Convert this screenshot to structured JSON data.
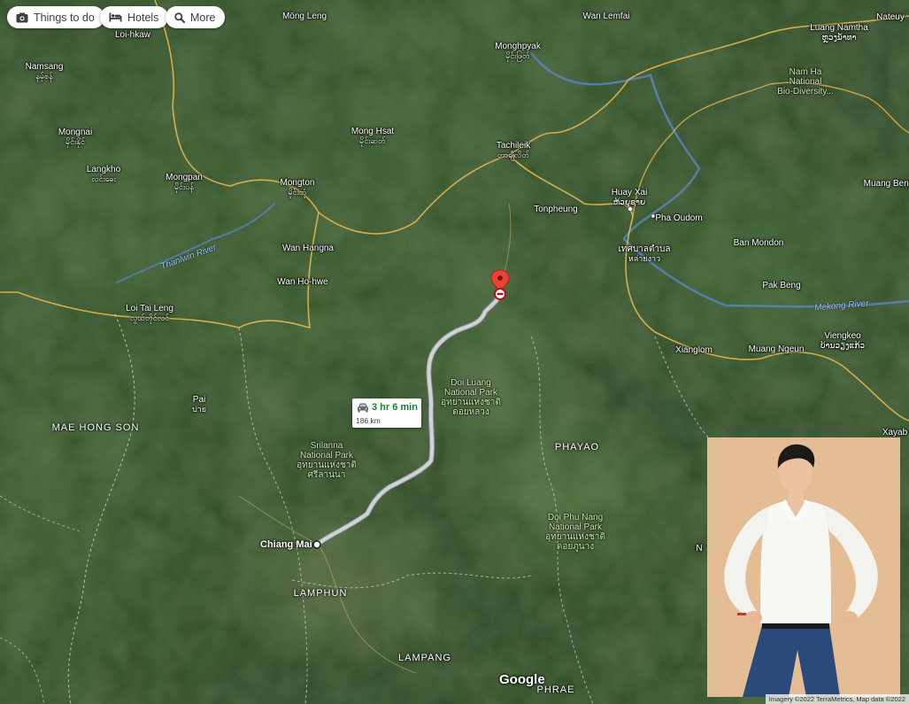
{
  "toolbar": {
    "chips": [
      {
        "label": "Things to do",
        "icon": "camera-icon"
      },
      {
        "label": "Hotels",
        "icon": "bed-icon"
      },
      {
        "label": "More",
        "icon": "search-icon"
      }
    ]
  },
  "places": {
    "mong_leng": "Möng Leng",
    "wan_lemfai": "Wan Lemfai",
    "nateuy": "Nateuy",
    "loi_hkaw": "Loi-hkaw",
    "monghpyak": "Monghpyak",
    "monghpyak_local": "မိုင်းဖြတ်",
    "luang_namtha": "Luang Namtha",
    "luang_namtha_local": "ຫຼວງນ້ຳທາ",
    "namsang": "Namsang",
    "namsang_local": "နမ့်စန်",
    "mongnai": "Mongnai",
    "mongnai_local": "မိုင်းနိုင်",
    "mong_hsat": "Mong Hsat",
    "mong_hsat_local": "မိုင်းဆတ်",
    "tachileik": "Tachileik",
    "tachileik_local": "တာချီလိတ်",
    "langkho": "Langkho",
    "langkho_local": "လင်းခေး",
    "mongpan": "Mongpan",
    "mongpan_local": "မိုင်းပန်",
    "mongton": "Mongton",
    "mongton_local": "မိုင်းတုံ",
    "huay_xai": "Huay Xai",
    "huay_xai_local": "ຫ້ວຍຊາຍ",
    "muang_beng": "Muang Beng",
    "tonpheung": "Tonpheung",
    "pha_oudom": "Pha Oudom",
    "wan_hangna": "Wan Hangna",
    "ban_mondon": "Ban Mondon",
    "thoeng": "เทศบาลตำบล",
    "thoeng_2": "หล่ายงาว",
    "wan_ho_hwe": "Wan Ho-hwe",
    "pak_beng": "Pak Beng",
    "loi_tai_leng": "Loi Tai Leng",
    "loi_tai_leng_local": "လွယ်တိုင်လင်",
    "xianglom": "Xianglom",
    "muang_ngeun": "Muang Ngeun",
    "viengkeo": "Viengkeo",
    "viengkeo_local": "ບ້ານວຽງແກ້ວ",
    "pai": "Pai",
    "pai_local": "ปาย",
    "xayabury": "Xayab",
    "chiang_mai": "Chiang Mai",
    "nan_edge": "N"
  },
  "regions": {
    "mae_hong_son": "MAE HONG SON",
    "phayao": "PHAYAO",
    "lamphun": "LAMPHUN",
    "lampang": "LAMPANG",
    "phrae": "PHRAE"
  },
  "rivers": {
    "thanlwin": "Thanlwin River",
    "mekong": "Mekong River"
  },
  "parks": {
    "nam_ha_1": "Nam Ha",
    "nam_ha_2": "National",
    "nam_ha_3": "Bio-Diversity...",
    "doi_luang_1": "Doi Luang",
    "doi_luang_2": "National Park",
    "doi_luang_3": "อุทยานแห่งชาติ",
    "doi_luang_4": "ดอยหลวง",
    "srilanna_1": "Srilanna",
    "srilanna_2": "National Park",
    "srilanna_3": "อุทยานแห่งชาติ",
    "srilanna_4": "ศรีลานนา",
    "doi_phu_nang_1": "Doi Phu Nang",
    "doi_phu_nang_2": "National Park",
    "doi_phu_nang_3": "อุทยานแห่งชาติ",
    "doi_phu_nang_4": "ดอยภูนาง"
  },
  "route": {
    "duration": "3 hr 6 min",
    "distance": "186 km",
    "mode_icon": "car-icon",
    "color": "#cfd3d6"
  },
  "branding": {
    "logo": "Google",
    "attribution": "Imagery ©2022 TerraMetrics, Map data ©2022"
  },
  "colors": {
    "border": "#e8b64c",
    "border_dashed": "#d9d9d9",
    "river": "#5a86c8",
    "marker": "#ea4335"
  }
}
